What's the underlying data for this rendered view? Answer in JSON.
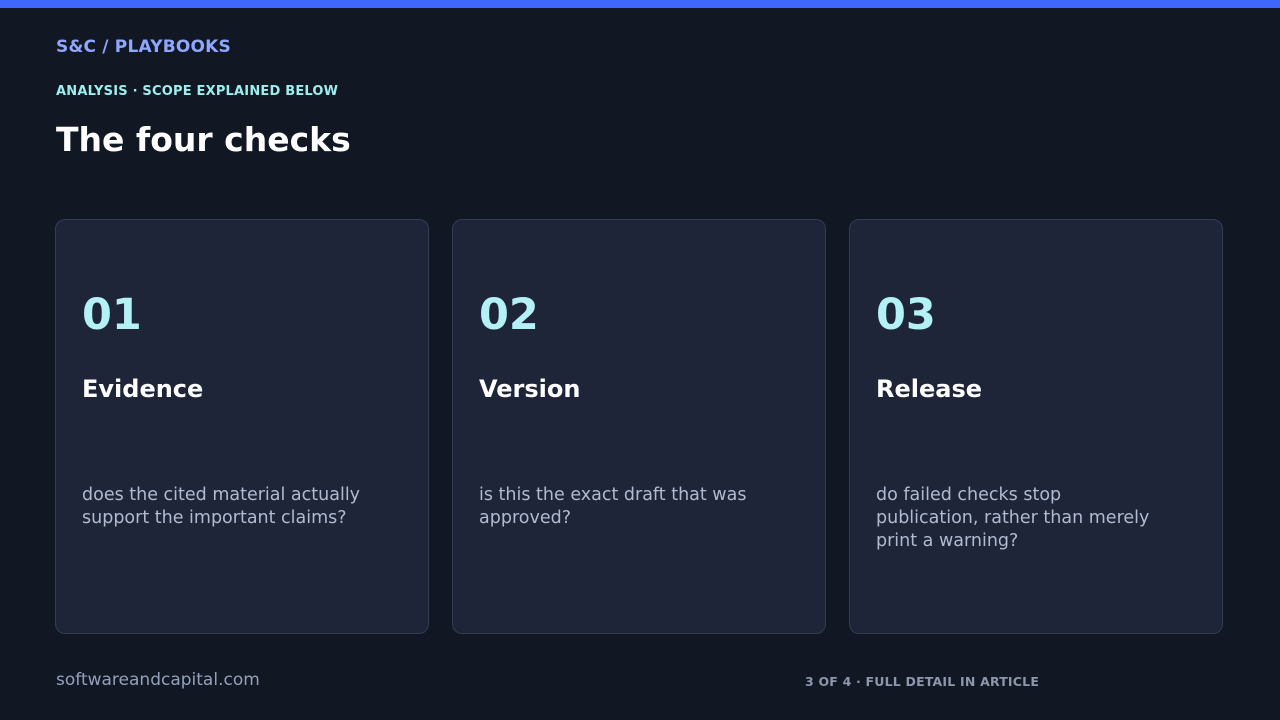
{
  "header": {
    "brand": "S&C / PLAYBOOKS",
    "eyebrow": "ANALYSIS · SCOPE EXPLAINED BELOW",
    "title": "The four checks"
  },
  "cards": [
    {
      "number": "01",
      "title": "Evidence",
      "description": "does the cited material actually support the important claims?"
    },
    {
      "number": "02",
      "title": "Version",
      "description": "is this the exact draft that was approved?"
    },
    {
      "number": "03",
      "title": "Release",
      "description": "do failed checks stop publication, rather than merely print a warning?"
    }
  ],
  "footer": {
    "site": "softwareandcapital.com",
    "progress": "3 OF 4 · FULL DETAIL IN ARTICLE"
  },
  "colors": {
    "background": "#111723",
    "accent_bar": "#3f66ff",
    "brand": "#8fa8ff",
    "eyebrow": "#9eeef0",
    "card_background": "#1e2538",
    "card_number": "#b3f1f6"
  }
}
